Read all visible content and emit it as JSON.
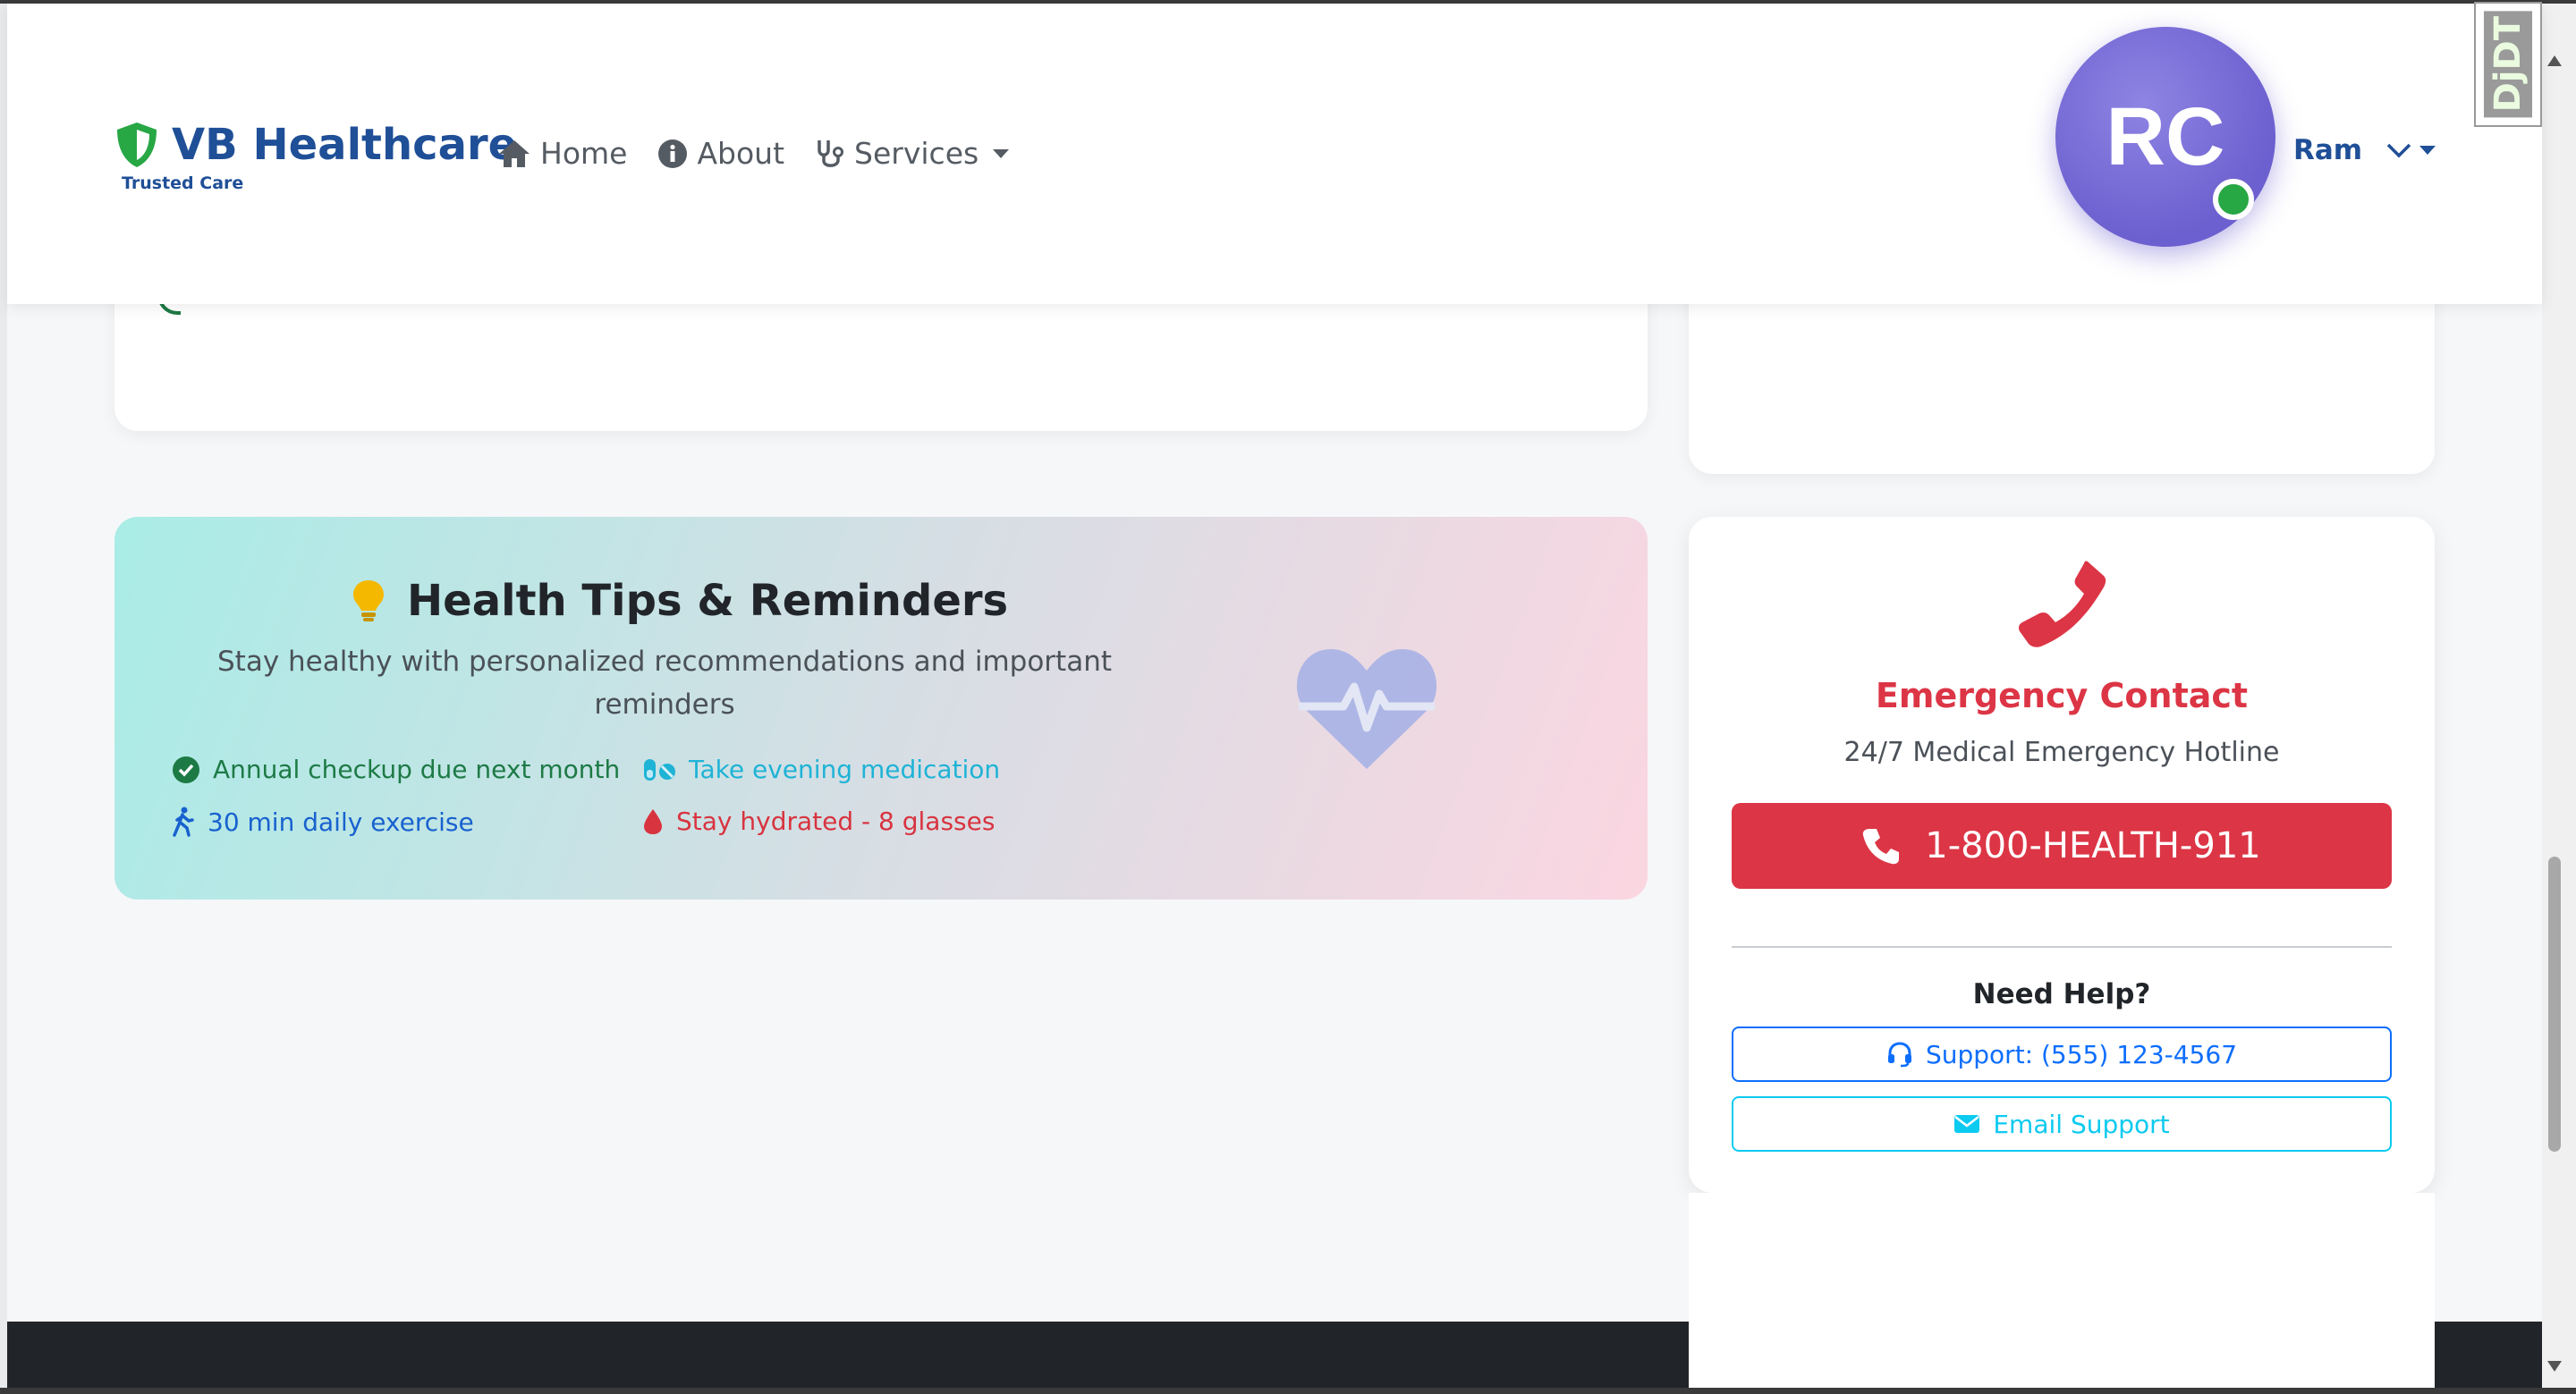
{
  "brand": {
    "name": "VB Healthcare",
    "tagline": "Trusted Care",
    "color": "#1f4f97",
    "shield_color": "#28a745"
  },
  "nav": {
    "items": [
      {
        "label": "Home",
        "icon": "home-icon"
      },
      {
        "label": "About",
        "icon": "info-icon"
      },
      {
        "label": "Services",
        "icon": "stethoscope-icon"
      }
    ]
  },
  "user": {
    "initials": "RC",
    "name": "Ram",
    "status": "online",
    "status_color": "#28a745",
    "avatar_color": "#6c5fcf"
  },
  "debug_toolbar": {
    "label": "DjDT"
  },
  "tips": {
    "title": "Health Tips & Reminders",
    "subtitle": "Stay healthy with personalized recommendations and important reminders",
    "items": [
      {
        "text": "Annual checkup due next month",
        "icon": "check-circle-icon",
        "color": "#1d7a45"
      },
      {
        "text": "Take evening medication",
        "icon": "pills-icon",
        "color": "#1fb3d6"
      },
      {
        "text": "30 min daily exercise",
        "icon": "walking-icon",
        "color": "#1861cf"
      },
      {
        "text": "Stay hydrated - 8 glasses",
        "icon": "water-drop-icon",
        "color": "#d8343f"
      }
    ]
  },
  "emergency": {
    "title": "Emergency Contact",
    "subtitle": "24/7 Medical Emergency Hotline",
    "hotline": "1-800-HEALTH-911",
    "help_title": "Need Help?",
    "support_label": "Support: (555) 123-4567",
    "email_label": "Email Support",
    "accent": "#dc3545"
  }
}
